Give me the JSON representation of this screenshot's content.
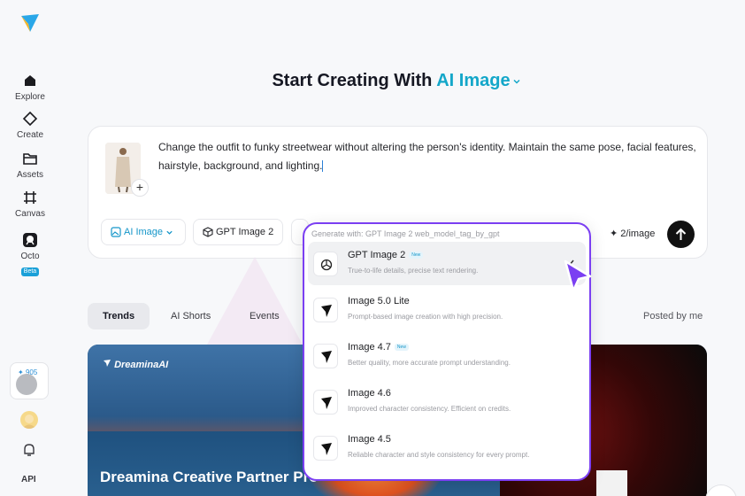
{
  "sidebar": {
    "items": [
      {
        "label": "Explore"
      },
      {
        "label": "Create"
      },
      {
        "label": "Assets"
      },
      {
        "label": "Canvas"
      },
      {
        "label": "Octo",
        "badge": "Beta"
      }
    ],
    "credits": "905",
    "api_label": "API"
  },
  "header": {
    "prefix": "Start Creating With ",
    "accent": "AI Image"
  },
  "prompt": {
    "text": "Change the outfit to funky streetwear without altering the person's identity. Maintain the same pose, facial features, hairstyle, background, and lighting.",
    "chips": {
      "mode": "AI Image",
      "model": "GPT Image 2"
    },
    "cost": "2/image"
  },
  "dropdown": {
    "header": "Generate with: GPT Image 2 web_model_tag_by_gpt",
    "items": [
      {
        "name": "GPT Image 2",
        "tag": "New",
        "desc": "True-to-life details, precise text rendering.",
        "selected": true
      },
      {
        "name": "Image 5.0 Lite",
        "tag": "",
        "desc": "Prompt-based image creation with high precision.",
        "selected": false
      },
      {
        "name": "Image 4.7",
        "tag": "New",
        "desc": "Better quality, more accurate prompt understanding.",
        "selected": false
      },
      {
        "name": "Image 4.6",
        "tag": "",
        "desc": "Improved character consistency. Efficient on credits.",
        "selected": false
      },
      {
        "name": "Image 4.5",
        "tag": "",
        "desc": "Reliable character and style consistency for every prompt.",
        "selected": false
      }
    ]
  },
  "tabs": [
    {
      "label": "Trends",
      "active": true
    },
    {
      "label": "AI Shorts",
      "active": false
    },
    {
      "label": "Events",
      "active": false
    }
  ],
  "posted_by": "Posted by me",
  "banner": {
    "brand": "DreaminaAI",
    "title": "Dreamina Creative Partner Pro"
  },
  "colors": {
    "accent": "#14a7c9",
    "dropdown_border": "#7b3ff2",
    "send_button": "#111111"
  }
}
